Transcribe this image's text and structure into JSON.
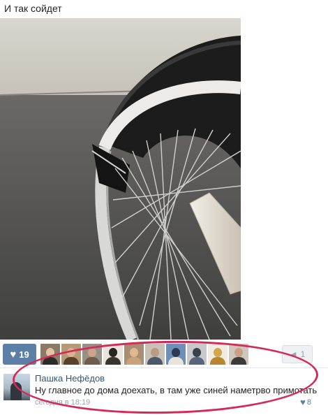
{
  "post": {
    "caption": "И так сойдет"
  },
  "likes": {
    "count": "19",
    "heart_icon": "heart-icon",
    "avatar_count": 10,
    "share_count": "1"
  },
  "comment": {
    "author": "Пашка Нефёдов",
    "text": "Ну главное до дома доехать,  в там уже синей наметрво примотать",
    "time": "сегодня в 18:19",
    "likes": "8"
  },
  "colors": {
    "accent": "#5b7fa6",
    "link": "#2b587a",
    "highlight": "#d42a57"
  }
}
